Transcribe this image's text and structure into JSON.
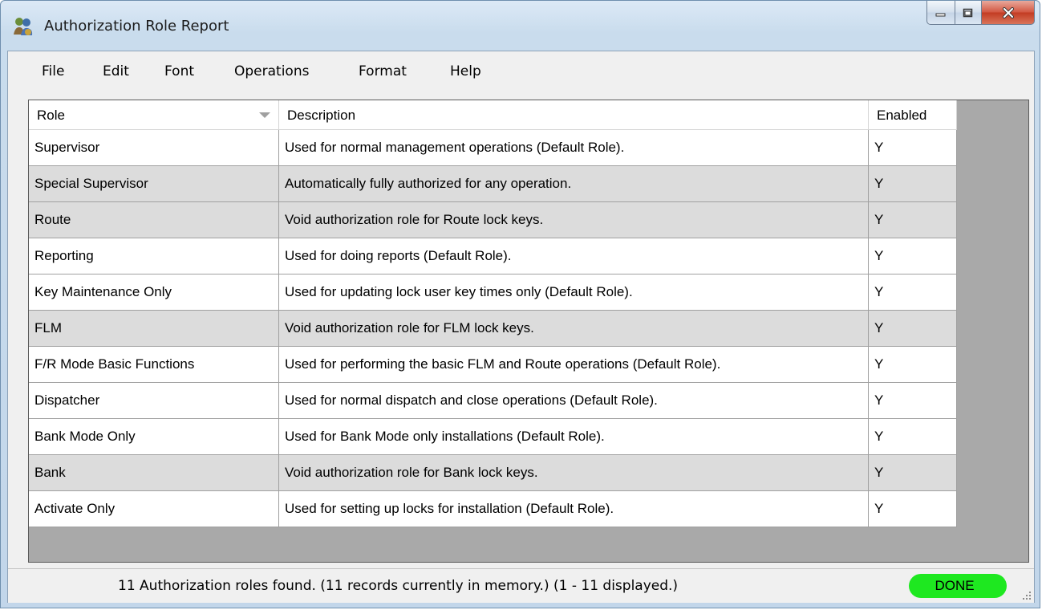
{
  "window": {
    "title": "Authorization Role Report",
    "icon": "users-icon"
  },
  "menu": [
    {
      "label": "File"
    },
    {
      "label": "Edit"
    },
    {
      "label": "Font"
    },
    {
      "label": "Operations"
    },
    {
      "label": "Format"
    },
    {
      "label": "Help"
    }
  ],
  "table": {
    "columns": [
      "Role",
      "Description",
      "Enabled"
    ],
    "sorted_column": "Role",
    "rows": [
      {
        "role": "Supervisor",
        "description": "Used for normal management operations (Default Role).",
        "enabled": "Y"
      },
      {
        "role": "Special Supervisor",
        "description": "Automatically fully authorized for any operation.",
        "enabled": "Y"
      },
      {
        "role": "Route",
        "description": "Void authorization role for Route lock keys.",
        "enabled": "Y"
      },
      {
        "role": "Reporting",
        "description": "Used for doing reports (Default Role).",
        "enabled": "Y"
      },
      {
        "role": "Key Maintenance Only",
        "description": "Used for updating lock user key times only (Default Role).",
        "enabled": "Y"
      },
      {
        "role": "FLM",
        "description": "Void authorization role for FLM lock keys.",
        "enabled": "Y"
      },
      {
        "role": "F/R Mode Basic Functions",
        "description": "Used for performing the basic FLM and Route operations (Default Role).",
        "enabled": "Y"
      },
      {
        "role": "Dispatcher",
        "description": "Used for normal dispatch and close operations (Default Role).",
        "enabled": "Y"
      },
      {
        "role": "Bank Mode Only",
        "description": "Used for Bank Mode only installations (Default Role).",
        "enabled": "Y"
      },
      {
        "role": "Bank",
        "description": "Void authorization role for Bank lock keys.",
        "enabled": "Y"
      },
      {
        "role": "Activate Only",
        "description": "Used for setting up locks for installation (Default Role).",
        "enabled": "Y"
      }
    ]
  },
  "status": {
    "text": "11 Authorization roles found.  (11 records currently in memory.)  (1 - 11 displayed.)",
    "badge": "DONE",
    "badge_color": "#1ee820"
  },
  "colors": {
    "row_even": "#ffffff",
    "row_odd": "#dcdcdc",
    "grid_background": "#a9a9a9"
  }
}
